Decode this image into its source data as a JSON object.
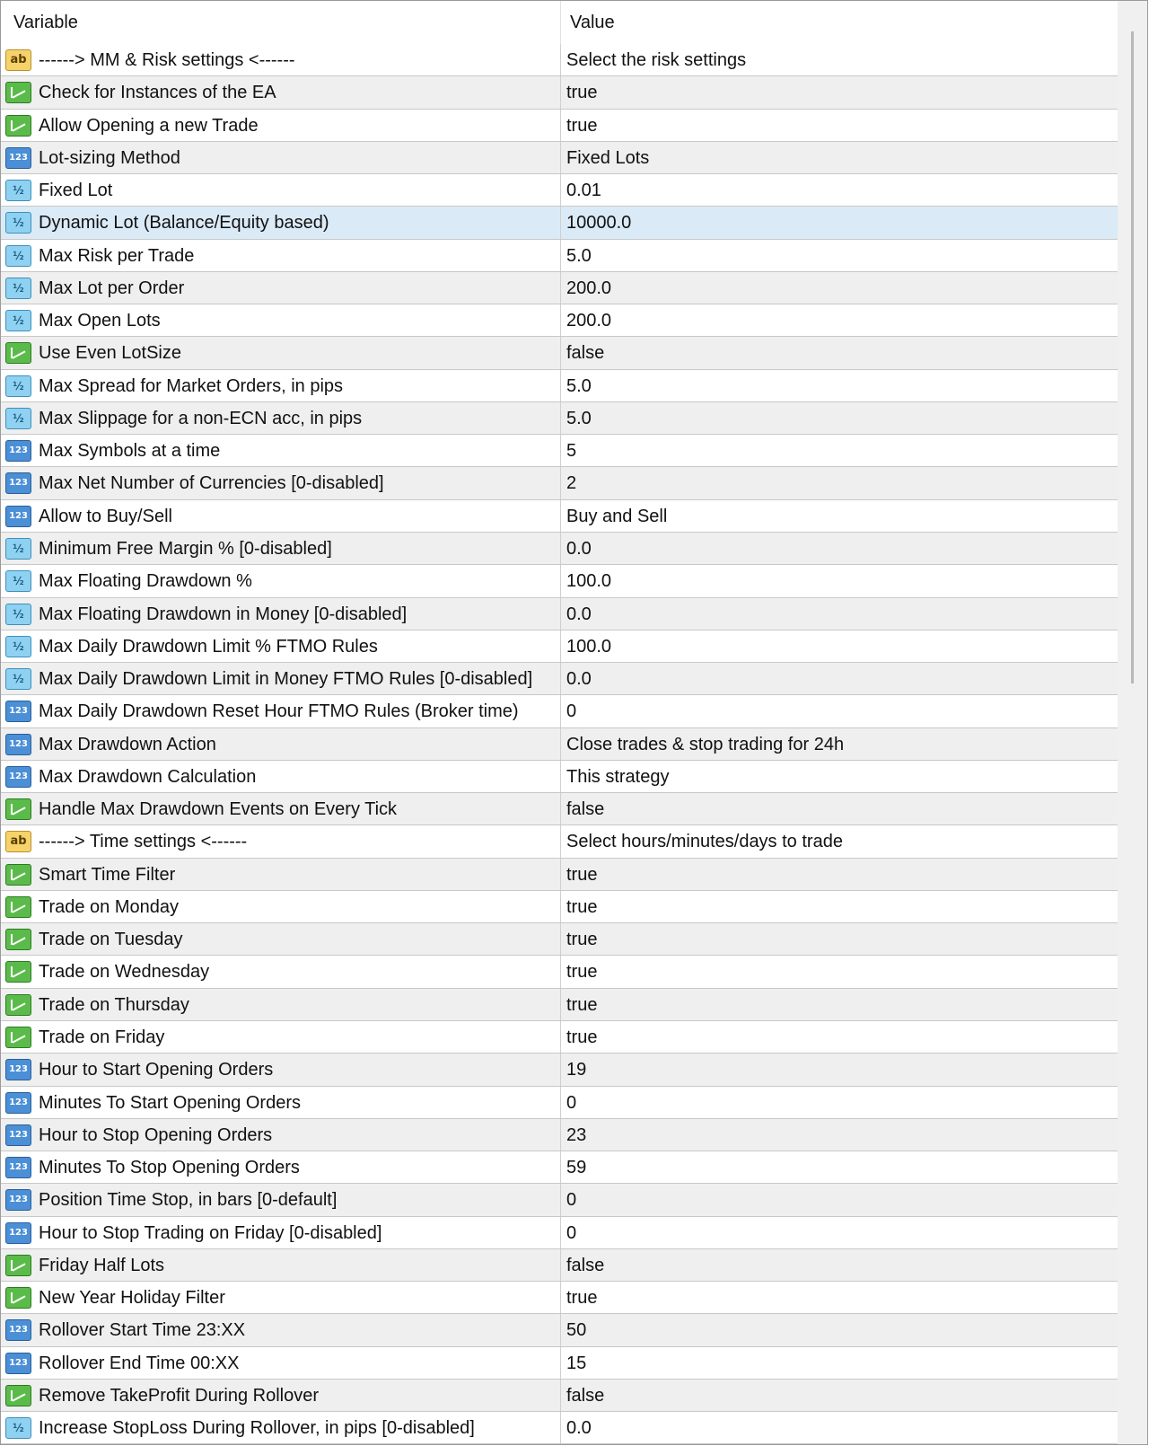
{
  "header": {
    "variable": "Variable",
    "value": "Value"
  },
  "colors": {
    "selected_row": "#dbeaf7",
    "alt_row": "#efefef"
  },
  "rows": [
    {
      "icon": "ab",
      "label": "------> MM & Risk settings <------",
      "value": "Select the risk settings"
    },
    {
      "icon": "bool",
      "label": "Check for Instances of the EA",
      "value": "true"
    },
    {
      "icon": "bool",
      "label": "Allow Opening a new Trade",
      "value": "true"
    },
    {
      "icon": "num",
      "label": "Lot-sizing Method",
      "value": "Fixed Lots"
    },
    {
      "icon": "frac",
      "label": "Fixed Lot",
      "value": "0.01"
    },
    {
      "icon": "frac",
      "label": "Dynamic Lot (Balance/Equity based)",
      "value": "10000.0",
      "selected": true
    },
    {
      "icon": "frac",
      "label": "Max Risk per Trade",
      "value": "5.0"
    },
    {
      "icon": "frac",
      "label": "Max Lot per Order",
      "value": "200.0"
    },
    {
      "icon": "frac",
      "label": "Max Open Lots",
      "value": "200.0"
    },
    {
      "icon": "bool",
      "label": "Use Even LotSize",
      "value": "false"
    },
    {
      "icon": "frac",
      "label": "Max Spread for Market Orders, in pips",
      "value": "5.0"
    },
    {
      "icon": "frac",
      "label": "Max Slippage for a non-ECN acc, in pips",
      "value": "5.0"
    },
    {
      "icon": "num",
      "label": "Max Symbols at a time",
      "value": "5"
    },
    {
      "icon": "num",
      "label": "Max Net Number of Currencies [0-disabled]",
      "value": "2"
    },
    {
      "icon": "num",
      "label": "Allow to Buy/Sell",
      "value": "Buy and Sell"
    },
    {
      "icon": "frac",
      "label": "Minimum Free Margin % [0-disabled]",
      "value": "0.0"
    },
    {
      "icon": "frac",
      "label": "Max Floating Drawdown %",
      "value": "100.0"
    },
    {
      "icon": "frac",
      "label": "Max Floating Drawdown in Money [0-disabled]",
      "value": "0.0"
    },
    {
      "icon": "frac",
      "label": "Max Daily Drawdown Limit % FTMO Rules",
      "value": "100.0"
    },
    {
      "icon": "frac",
      "label": "Max Daily Drawdown Limit in Money FTMO Rules [0-disabled]",
      "value": "0.0"
    },
    {
      "icon": "num",
      "label": "Max Daily Drawdown Reset Hour FTMO Rules (Broker time)",
      "value": "0"
    },
    {
      "icon": "num",
      "label": "Max Drawdown Action",
      "value": "Close trades & stop trading for 24h"
    },
    {
      "icon": "num",
      "label": "Max Drawdown Calculation",
      "value": "This strategy"
    },
    {
      "icon": "bool",
      "label": "Handle Max Drawdown Events on Every Tick",
      "value": "false"
    },
    {
      "icon": "ab",
      "label": "------> Time settings <------",
      "value": "Select hours/minutes/days to trade"
    },
    {
      "icon": "bool",
      "label": "Smart Time Filter",
      "value": "true"
    },
    {
      "icon": "bool",
      "label": "Trade on Monday",
      "value": "true"
    },
    {
      "icon": "bool",
      "label": "Trade on Tuesday",
      "value": "true"
    },
    {
      "icon": "bool",
      "label": "Trade on Wednesday",
      "value": "true"
    },
    {
      "icon": "bool",
      "label": "Trade on Thursday",
      "value": "true"
    },
    {
      "icon": "bool",
      "label": "Trade on Friday",
      "value": "true"
    },
    {
      "icon": "num",
      "label": "Hour to Start Opening Orders",
      "value": "19"
    },
    {
      "icon": "num",
      "label": "Minutes To Start Opening Orders",
      "value": "0"
    },
    {
      "icon": "num",
      "label": "Hour to Stop Opening Orders",
      "value": "23"
    },
    {
      "icon": "num",
      "label": "Minutes To Stop Opening Orders",
      "value": "59"
    },
    {
      "icon": "num",
      "label": "Position Time Stop, in bars [0-default]",
      "value": "0"
    },
    {
      "icon": "num",
      "label": "Hour to Stop Trading on Friday [0-disabled]",
      "value": "0"
    },
    {
      "icon": "bool",
      "label": "Friday Half Lots",
      "value": "false"
    },
    {
      "icon": "bool",
      "label": "New Year Holiday Filter",
      "value": "true"
    },
    {
      "icon": "num",
      "label": "Rollover Start Time 23:XX",
      "value": "50"
    },
    {
      "icon": "num",
      "label": "Rollover End Time 00:XX",
      "value": "15"
    },
    {
      "icon": "bool",
      "label": "Remove TakeProfit During Rollover",
      "value": "false"
    },
    {
      "icon": "frac",
      "label": "Increase StopLoss During Rollover, in pips [0-disabled]",
      "value": "0.0"
    }
  ]
}
